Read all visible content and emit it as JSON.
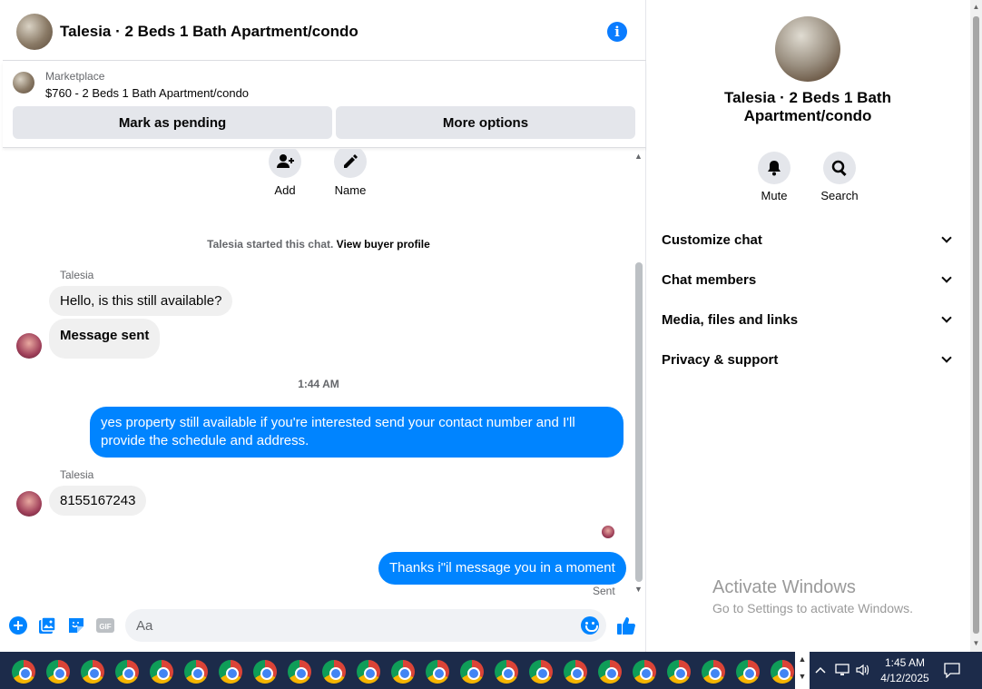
{
  "header": {
    "title": "Talesia · 2 Beds 1 Bath Apartment/condo",
    "info_icon": "info-icon"
  },
  "marketplace": {
    "label": "Marketplace",
    "listing": "$760 - 2 Beds 1 Bath Apartment/condo",
    "buttons": {
      "pending": "Mark as pending",
      "more": "More options"
    }
  },
  "chat": {
    "actions": {
      "add": "Add",
      "name": "Name"
    },
    "system_prefix": "Talesia started this chat.",
    "system_link": "View buyer profile",
    "messages": [
      {
        "sender": "Talesia",
        "text": "Hello, is this still available?"
      },
      {
        "text": "Message sent"
      },
      {
        "timestamp": "1:44 AM"
      },
      {
        "text": "yes property still available if you're interested send your contact number and I'll provide the schedule and address."
      },
      {
        "sender": "Talesia",
        "text": "8155167243"
      },
      {
        "text": "Thanks i\"il message you in a moment"
      }
    ],
    "status": "Sent"
  },
  "composer": {
    "placeholder": "Aa",
    "value": ""
  },
  "details": {
    "title": "Talesia · 2 Beds 1 Bath Apartment/condo",
    "buttons": {
      "mute": "Mute",
      "search": "Search"
    },
    "sections": [
      "Customize chat",
      "Chat members",
      "Media, files and links",
      "Privacy & support"
    ]
  },
  "watermark": {
    "line1": "Activate Windows",
    "line2": "Go to Settings to activate Windows."
  },
  "taskbar": {
    "time": "1:45 AM",
    "date": "4/12/2025"
  },
  "colors": {
    "accent": "#0084ff",
    "taskbar": "#1c2b4a",
    "bubble_in": "#f0f0f0"
  }
}
